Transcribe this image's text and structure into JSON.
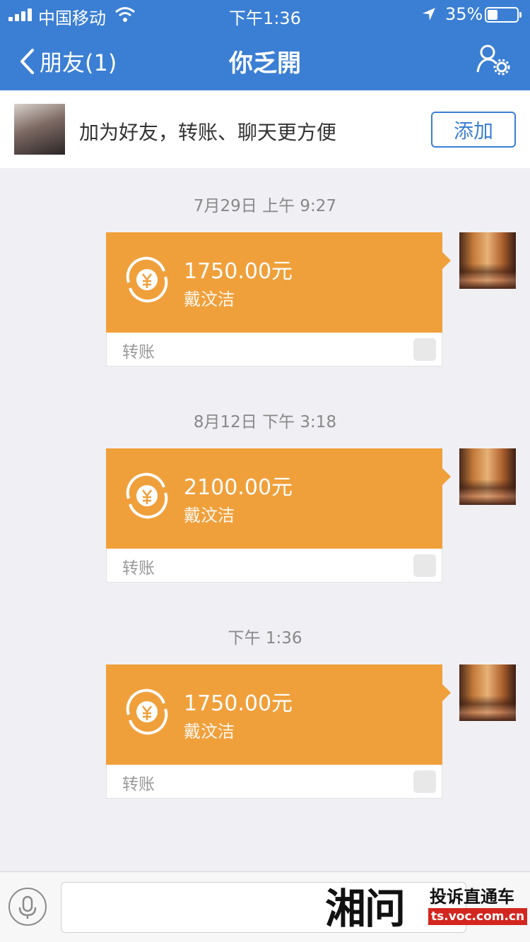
{
  "status_bar": {
    "carrier": "中国移动",
    "time": "下午1:36",
    "battery": "35%",
    "battery_level": 0.35
  },
  "nav": {
    "back_label": "朋友(1)",
    "title": "你乏開"
  },
  "banner": {
    "text": "加为好友，转账、聊天更方便",
    "add_label": "添加"
  },
  "messages": [
    {
      "time": "7月29日 上午 9:27",
      "amount": "1750.00元",
      "payee": "戴汶洁",
      "type": "转账"
    },
    {
      "time": "8月12日 下午 3:18",
      "amount": "2100.00元",
      "payee": "戴汶洁",
      "type": "转账"
    },
    {
      "time": "下午 1:36",
      "amount": "1750.00元",
      "payee": "戴汶洁",
      "type": "转账"
    }
  ],
  "watermark": {
    "logo": "湘问",
    "slogan": "投诉直通车",
    "url": "ts.voc.com.cn"
  },
  "colors": {
    "nav_blue": "#3b7fd4",
    "transfer_orange": "#f0a03b",
    "watermark_red": "#d3261f"
  }
}
